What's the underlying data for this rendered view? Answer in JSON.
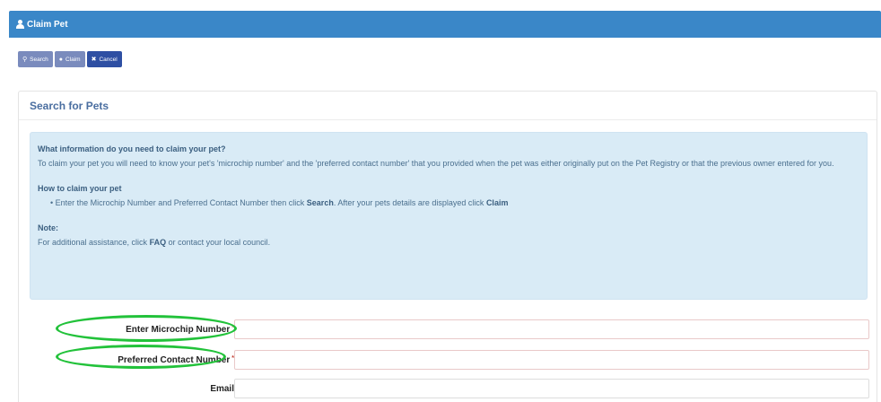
{
  "header": {
    "title": "Claim Pet"
  },
  "toolbar": {
    "search_label": "Search",
    "claim_label": "Claim",
    "cancel_label": "Cancel"
  },
  "panel": {
    "title": "Search for Pets",
    "info": {
      "heading1": "What information do you need to claim your pet?",
      "paragraph1": "To claim your pet you will need to know your pet's 'microchip number' and the 'preferred contact number' that you provided when the pet was either originally put on the Pet Registry or that the previous owner entered for you.",
      "heading2": "How to claim your pet",
      "bullet_prefix": "Enter the Microchip Number and Preferred Contact Number then click",
      "bullet_search": "Search",
      "bullet_middle": ". After your pets details are displayed click",
      "bullet_claim": "Claim",
      "heading3": "Note:",
      "note_prefix": "For additional assistance, click",
      "note_faq": "FAQ",
      "note_suffix": "or contact your local council."
    }
  },
  "form": {
    "microchip_label": "Enter Microchip Number",
    "microchip_value": "",
    "contact_label": "Preferred Contact Number",
    "contact_value": "",
    "email_label": "Email",
    "email_value": "",
    "required_mark": "*"
  },
  "colors": {
    "header": "#3a87c8",
    "info_bg": "#d9ebf6",
    "highlight": "#22c23a",
    "cancel_btn": "#2e4fa3"
  }
}
